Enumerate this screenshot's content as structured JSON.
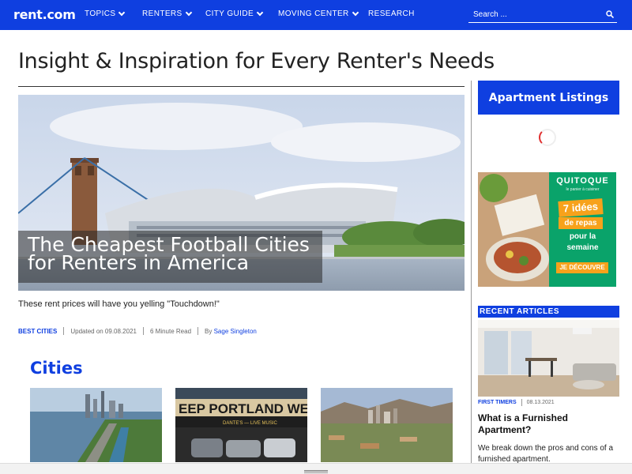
{
  "header": {
    "logo": "rent.com",
    "nav": [
      {
        "label": "TOPICS",
        "dropdown": true
      },
      {
        "label": "RENTERS",
        "dropdown": true
      },
      {
        "label": "CITY GUIDE",
        "dropdown": true
      },
      {
        "label": "MOVING CENTER",
        "dropdown": true
      },
      {
        "label": "RESEARCH",
        "dropdown": false
      }
    ],
    "search_placeholder": "Search ...",
    "brand_color": "#0f3fe0"
  },
  "main": {
    "page_title": "Insight & Inspiration for Every Renter's Needs",
    "hero": {
      "headline": "The Cheapest Football Cities for Renters in America",
      "dek": "These rent prices will have you yelling \"Touchdown!\"",
      "category": "BEST CITIES",
      "updated": "Updated on 09.08.2021",
      "read_time": "6 Minute Read",
      "by": "By",
      "author": "Sage Singleton"
    },
    "cities_section": {
      "title": "Cities",
      "card_images": [
        "chicago-lakefront-image",
        "portland-sign-image",
        "phoenix-skyline-image"
      ]
    }
  },
  "sidebar": {
    "listings_button": "Apartment Listings",
    "ad": {
      "brand": "QUITOQUE",
      "tagline": "le panier à cuisiner",
      "badge": "7 idées",
      "badge2": "de repas",
      "line1": "pour la",
      "line2": "semaine",
      "cta": "JE DÉCOUVRE"
    },
    "recent": {
      "heading": "RECENT ARTICLES",
      "category": "FIRST TIMERS",
      "date": "08.13.2021",
      "title": "What is a Furnished Apartment?",
      "dek": "We break down the pros and cons of a furnished apartment."
    }
  }
}
